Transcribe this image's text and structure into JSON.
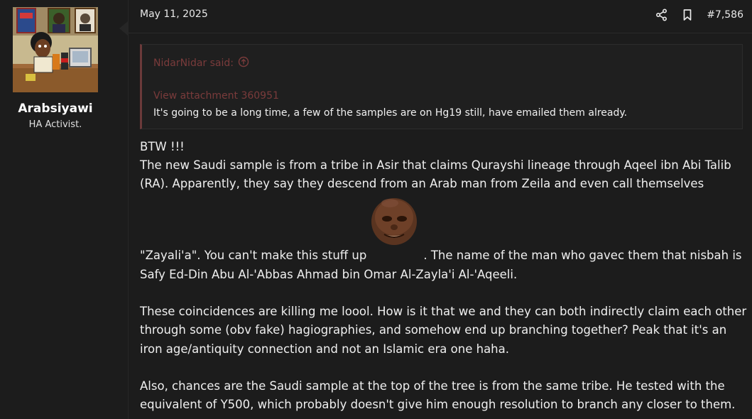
{
  "user": {
    "name": "Arabsiyawi",
    "title": "HA Activist."
  },
  "post": {
    "date": "May 11, 2025",
    "number": "#7,586",
    "icons": [
      "share-icon",
      "bookmark-icon"
    ]
  },
  "quote": {
    "author": "NidarNidar said:",
    "attachment": "View attachment 360951",
    "text": "It's going to be a long time, a few of the samples are on Hg19 still, have emailed them already."
  },
  "body": {
    "line1": "BTW !!!",
    "line2": "The new Saudi sample is from a tribe in Asir that claims Qurayshi lineage through Aqeel ibn Abi Talib",
    "line3": "(RA). Apparently, they say they descend from an Arab man from Zeila and even call themselves",
    "line4a": "\"Zayali'a\". You can't make this stuff up",
    "line4b": ". The name of the man who gavec them that nisbah is",
    "line5": "Safy Ed-Din Abu Al-'Abbas Ahmad bin Omar Al-Zayla'i Al-'Aqeeli.",
    "para2_line1": "These coincidences are killing me loool. How is it that we and they can both indirectly claim each other",
    "para2_line2": "through some (obv fake) hagiographies, and somehow end up branching together? Peak that it's an",
    "para2_line3": "iron age/antiquity connection and not an Islamic era one haha.",
    "para3_line1": "Also, chances are the Saudi sample at the top of the tree is from the same tribe. He tested with the",
    "para3_line2": "equivalent of Y500, which probably doesn't give him enough resolution to branch any closer to them."
  },
  "colors": {
    "background": "#1c1c1c",
    "quote_accent": "#7a3b3b",
    "text": "#efefef"
  }
}
